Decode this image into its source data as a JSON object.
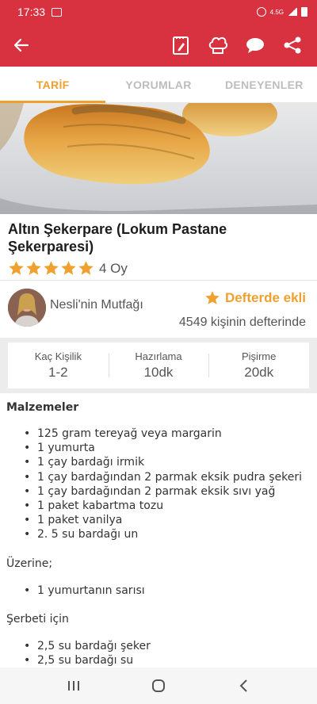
{
  "status_bar": {
    "time": "17:33",
    "network": "4.5G"
  },
  "toolbar": {
    "icons": [
      "back-arrow-icon",
      "clipboard-edit-icon",
      "chef-hat-icon",
      "comment-icon",
      "share-icon"
    ]
  },
  "tabs": [
    {
      "label": "TARİF",
      "active": true
    },
    {
      "label": "YORUMLAR",
      "active": false
    },
    {
      "label": "DENEYENLER",
      "active": false
    }
  ],
  "recipe": {
    "title": "Altın Şekerpare (Lokum Pastane Şekerparesi)",
    "stars": 5,
    "votes": "4 Oy"
  },
  "author": {
    "name": "Nesli'nin Mutfağı",
    "saved_label": "Defterde ekli",
    "saved_count": "4549 kişinin defterinde"
  },
  "stats": [
    {
      "label": "Kaç Kişilik",
      "value": "1-2"
    },
    {
      "label": "Hazırlama",
      "value": "10dk"
    },
    {
      "label": "Pişirme",
      "value": "20dk"
    }
  ],
  "content": {
    "heading": "Malzemeler",
    "ingredients": [
      "125 gram tereyağ veya margarin",
      "1 yumurta",
      "1 çay bardağı irmik",
      "1 çay bardağından 2 parmak eksik pudra şekeri",
      "1 çay bardağından 2 parmak eksik sıvı yağ",
      "1 paket kabartma tozu",
      "1 paket vanilya",
      "2. 5 su bardağı un"
    ],
    "topping_label": "Üzerine;",
    "topping": [
      "1 yumurtanın sarısı"
    ],
    "syrup_label": "Şerbeti için",
    "syrup": [
      "2,5 su bardağı şeker",
      "2,5 su bardağı su"
    ]
  },
  "colors": {
    "primary": "#d8313f",
    "accent": "#f0a02f"
  }
}
